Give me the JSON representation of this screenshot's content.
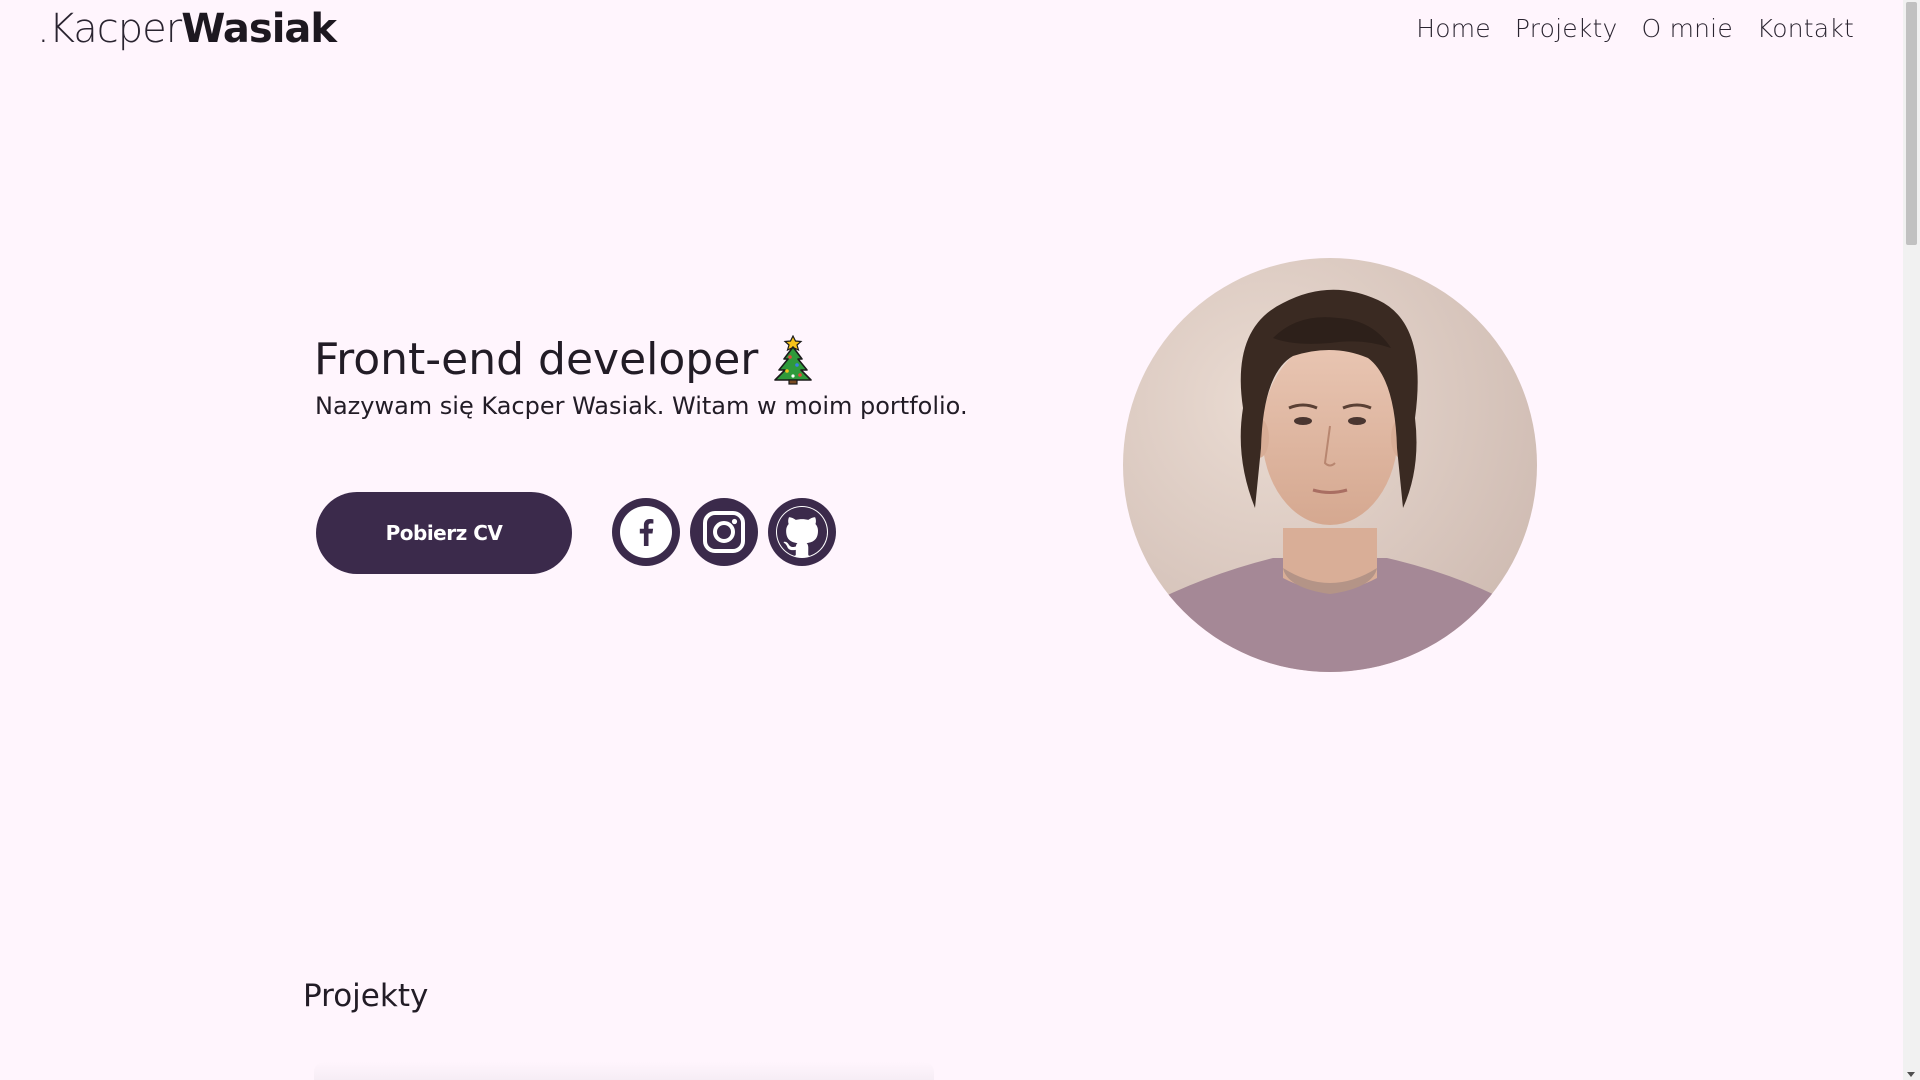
{
  "header": {
    "logo_prefix": ".Kacper",
    "logo_bold": "Wasiak",
    "nav": [
      {
        "label": "Home"
      },
      {
        "label": "Projekty"
      },
      {
        "label": "O mnie"
      },
      {
        "label": "Kontakt"
      }
    ]
  },
  "hero": {
    "title": "Front-end developer",
    "title_icon": "christmas-tree-icon",
    "subtitle": "Nazywam się Kacper Wasiak. Witam w moim portfolio.",
    "cv_button_label": "Pobierz CV",
    "socials": [
      {
        "icon": "facebook-icon"
      },
      {
        "icon": "instagram-icon"
      },
      {
        "icon": "github-icon"
      }
    ],
    "avatar": "profile-photo"
  },
  "sections": {
    "projects_title": "Projekty"
  },
  "colors": {
    "background": "#fff5fd",
    "accent": "#3b2a4b",
    "text": "#221c26"
  }
}
